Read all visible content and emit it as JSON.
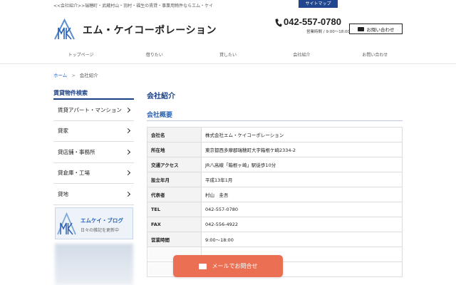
{
  "header": {
    "tagline": "<<会社紹介>>瑞穂町・武蔵村山・羽村・福生の賃貸・事業用物件ならエム・ケイ",
    "sitemap_label": "サイトマップ",
    "company_name": "エム・ケイコーポレーション",
    "phone": "042-557-0780",
    "hours": "営業時間 / 9:00〜18:00",
    "contact_label": "お問い合わせ",
    "logo_icon": "mk-mountain-logo-icon"
  },
  "nav": {
    "items": [
      {
        "label": "トップページ"
      },
      {
        "label": "借りたい"
      },
      {
        "label": "貸したい"
      },
      {
        "label": "会社紹介"
      },
      {
        "label": "お問い合わせ"
      }
    ]
  },
  "breadcrumb": {
    "home": "ホーム",
    "separator": ">",
    "current": "会社紹介"
  },
  "sidebar": {
    "title": "賃貸物件検索",
    "items": [
      {
        "label": "賃貸アパート・マンション"
      },
      {
        "label": "貸家"
      },
      {
        "label": "貸店舗・事務所"
      },
      {
        "label": "貸倉庫・工場"
      },
      {
        "label": "貸地"
      }
    ],
    "blog_title": "エムケイ・ブログ",
    "blog_subtitle": "日々の雑記を更新中"
  },
  "main": {
    "page_title": "会社紹介",
    "section_title": "会社概要",
    "rows": [
      {
        "key": "会社名",
        "value": "株式会社エム・ケイコーポレーション"
      },
      {
        "key": "所在地",
        "value": "東京都西多摩郡瑞穂町大字箱根ケ崎2334-2"
      },
      {
        "key": "交通アクセス",
        "value": "JR八高線「箱根ヶ崎」駅徒歩10分"
      },
      {
        "key": "設立年月",
        "value": "平成13年1月"
      },
      {
        "key": "代表者",
        "value": "村山　圭吾"
      },
      {
        "key": "TEL",
        "value": "042-557-0780"
      },
      {
        "key": "FAX",
        "value": "042-556-4922"
      },
      {
        "key": "営業時間",
        "value": "9:00〜18:00"
      }
    ]
  },
  "cta": {
    "mail_label": "メールでお問合せ"
  },
  "colors": {
    "brand_navy": "#1b3f85",
    "link_blue": "#2a62b5",
    "cta_orange": "#eb6f52"
  }
}
